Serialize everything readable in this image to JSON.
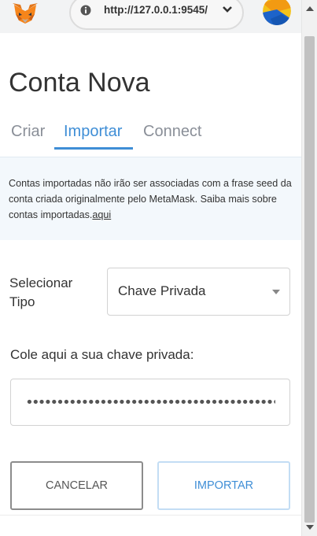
{
  "header": {
    "network_url": "http://127.0.0.1:9545/",
    "fox_icon": "metamask-fox-icon",
    "info_icon": "info-circle-icon",
    "chevron_icon": "chevron-down-icon",
    "avatar_icon": "account-avatar-icon"
  },
  "page": {
    "title": "Conta Nova"
  },
  "tabs": [
    {
      "label": "Criar",
      "active": false
    },
    {
      "label": "Importar",
      "active": true
    },
    {
      "label": "Connect",
      "active": false
    }
  ],
  "notice": {
    "text": "Contas importadas não irão ser associadas com a frase seed da conta criada originalmente pelo MetaMask. Saiba mais sobre contas importadas.",
    "link": "aqui"
  },
  "form": {
    "type_label": "Selecionar Tipo",
    "type_value": "Chave Privada",
    "key_label": "Cole aqui a sua chave privada:",
    "key_value": "••••••••••••••••••••••••••••••••••••••••••••••••••••••••••••••••"
  },
  "buttons": {
    "cancel": "CANCELAR",
    "import": "IMPORTAR"
  },
  "colors": {
    "accent": "#3f8ed6",
    "notice_bg": "#f3f8fc",
    "tab_inactive": "#8a8f98"
  }
}
